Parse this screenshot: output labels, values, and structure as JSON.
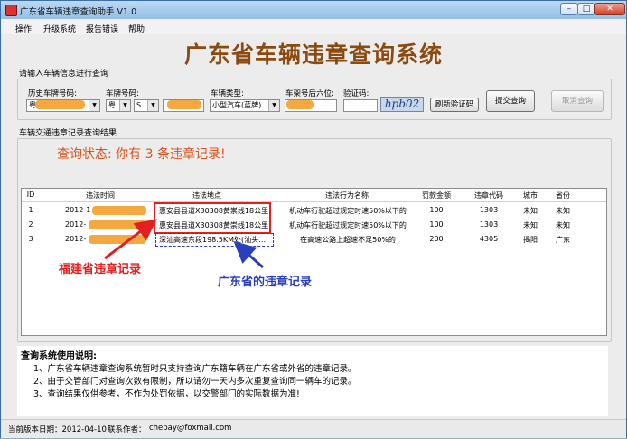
{
  "window": {
    "title": "广东省车辆违章查询助手 V1.0",
    "min": "–",
    "max": "□",
    "close": "✕"
  },
  "menu": [
    "操作",
    "升级系统",
    "报告错误",
    "帮助"
  ],
  "app_title": "广东省车辆违章查询系统",
  "input_section": {
    "heading": "请输入车辆信息进行查询",
    "history_label": "历史车牌号码:",
    "history_value": "粤",
    "plate_label": "车牌号码:",
    "plate_prefix": "粤",
    "plate_letter": "S",
    "vehicle_type_label": "车辆类型:",
    "vehicle_type_value": "小型汽车(蓝牌)",
    "frame_label": "车架号后六位:",
    "captcha_label": "验证码:",
    "captcha_image_text": "hpb02",
    "refresh_captcha": "刷新验证码",
    "submit": "提交查询",
    "cancel": "取消查询"
  },
  "results_section": {
    "heading": "车辆交通违章记录查询结果",
    "status": "查询状态: 你有 3 条违章记录!"
  },
  "table": {
    "columns": [
      "ID",
      "违法时间",
      "违法地点",
      "违法行为名称",
      "罚款金额",
      "违章代码",
      "城市",
      "省份"
    ],
    "rows": [
      {
        "id": "1",
        "time": "2012-1",
        "place": "惠安县县道X30308黄崇线18公里",
        "act": "机动车行驶超过规定时速50%以下的",
        "fine": "100",
        "code": "1303",
        "city": "未知",
        "province": "未知"
      },
      {
        "id": "2",
        "time": "2012-",
        "place": "惠安县县道X30308黄崇线18公里",
        "act": "机动车行驶超过规定时速50%以下的",
        "fine": "100",
        "code": "1303",
        "city": "未知",
        "province": "未知"
      },
      {
        "id": "3",
        "time": "2012-",
        "place": "深汕高速东段198.5KM处(汕头往...",
        "act": "在高速公路上超速不足50%的",
        "fine": "200",
        "code": "4305",
        "city": "揭阳",
        "province": "广东"
      }
    ]
  },
  "annotations": {
    "fujian": "福建省违章记录",
    "guangdong": "广东省的违章记录"
  },
  "notes": {
    "title": "查询系统使用说明:",
    "items": [
      "1、广东省车辆违章查询系统暂时只支持查询广东籍车辆在广东省或外省的违章记录。",
      "2、由于交管部门对查询次数有限制，所以请勿一天内多次重复查询同一辆车的记录。",
      "3、查询结果仅供参考，不作为处罚依据，以交警部门的实际数据为准!"
    ]
  },
  "statusbar": {
    "version": "当前版本日期：2012-04-10",
    "contact_label": "联系作者：",
    "email": "chepay@foxmail.com"
  }
}
